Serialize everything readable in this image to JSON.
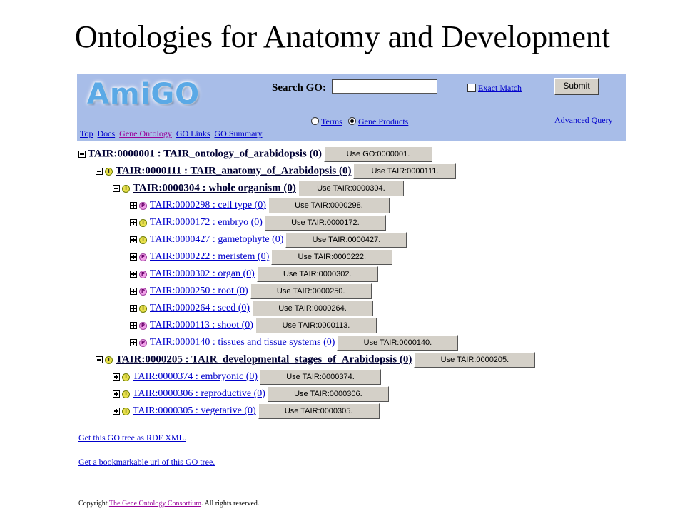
{
  "slide_title": "Ontologies for Anatomy and Development",
  "header": {
    "logo_text": "AmiGO",
    "search_label": "Search GO:",
    "search_value": "",
    "exact_match_label": "Exact Match",
    "submit_label": "Submit",
    "radio_terms_label": "Terms",
    "radio_gene_products_label": "Gene Products",
    "selected_radio": "Gene Products",
    "advanced_query_label": "Advanced Query",
    "nav_links": [
      "Top",
      "Docs",
      "Gene Ontology",
      "GO Links",
      "GO Summary"
    ]
  },
  "tree": [
    {
      "toggle": "minus",
      "rel": "",
      "label": "TAIR:0000001 : TAIR_ontology_of_arabidopsis (0)",
      "button": "Use GO:0000001."
    },
    {
      "toggle": "minus",
      "rel": "I",
      "label": "TAIR:0000111 : TAIR_anatomy_of_Arabidopsis (0)",
      "button": "Use TAIR:0000111."
    },
    {
      "toggle": "minus",
      "rel": "I",
      "label": "TAIR:0000304 : whole organism (0)",
      "button": "Use TAIR:0000304."
    },
    {
      "toggle": "plus",
      "rel": "P",
      "label": "TAIR:0000298 : cell type (0)",
      "button": "Use TAIR:0000298."
    },
    {
      "toggle": "plus",
      "rel": "I",
      "label": "TAIR:0000172 : embryo (0)",
      "button": "Use TAIR:0000172."
    },
    {
      "toggle": "plus",
      "rel": "I",
      "label": "TAIR:0000427 : gametophyte (0)",
      "button": "Use TAIR:0000427."
    },
    {
      "toggle": "plus",
      "rel": "P",
      "label": "TAIR:0000222 : meristem (0)",
      "button": "Use TAIR:0000222."
    },
    {
      "toggle": "plus",
      "rel": "P",
      "label": "TAIR:0000302 : organ (0)",
      "button": "Use TAIR:0000302."
    },
    {
      "toggle": "plus",
      "rel": "P",
      "label": "TAIR:0000250 : root (0)",
      "button": "Use TAIR:0000250."
    },
    {
      "toggle": "plus",
      "rel": "I",
      "label": "TAIR:0000264 : seed (0)",
      "button": "Use TAIR:0000264."
    },
    {
      "toggle": "plus",
      "rel": "P",
      "label": "TAIR:0000113 : shoot (0)",
      "button": "Use TAIR:0000113."
    },
    {
      "toggle": "plus",
      "rel": "P",
      "label": "TAIR:0000140 : tissues and tissue systems (0)",
      "button": "Use TAIR:0000140."
    },
    {
      "toggle": "minus",
      "rel": "I",
      "label": "TAIR:0000205 : TAIR_developmental_stages_of_Arabidopsis (0)",
      "button": "Use TAIR:0000205."
    },
    {
      "toggle": "plus",
      "rel": "I",
      "label": "TAIR:0000374 : embryonic (0)",
      "button": "Use TAIR:0000374."
    },
    {
      "toggle": "plus",
      "rel": "I",
      "label": "TAIR:0000306 : reproductive (0)",
      "button": "Use TAIR:0000306."
    },
    {
      "toggle": "plus",
      "rel": "I",
      "label": "TAIR:0000305 : vegetative (0)",
      "button": "Use TAIR:0000305."
    }
  ],
  "footer": {
    "rdf_link": "Get this GO tree as RDF XML.",
    "bookmark_link": "Get a bookmarkable url of this GO tree.",
    "copyright_prefix": "Copyright",
    "copyright_link": "The Gene Ontology Consortium",
    "copyright_suffix": ". All rights reserved."
  }
}
